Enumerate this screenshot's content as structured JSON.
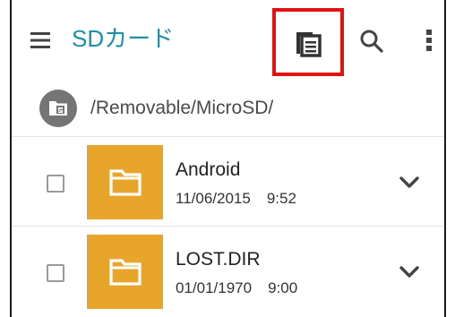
{
  "app_title": "SDカード",
  "toolbar": {
    "menu_icon": "hamburger-menu-icon",
    "paste_icon": "clipboard-paste-icon",
    "search_icon": "search-icon",
    "more_icon": "more-vertical-icon",
    "highlight_color": "#e31212"
  },
  "path": {
    "icon": "sd-card-icon",
    "text": "/Removable/MicroSD/"
  },
  "files": [
    {
      "name": "Android",
      "date": "11/06/2015",
      "time": "9:52",
      "icon": "folder-icon"
    },
    {
      "name": "LOST.DIR",
      "date": "01/01/1970",
      "time": "9:00",
      "icon": "folder-icon"
    }
  ],
  "colors": {
    "accent": "#1b8fa6",
    "folder": "#e8a52c"
  }
}
